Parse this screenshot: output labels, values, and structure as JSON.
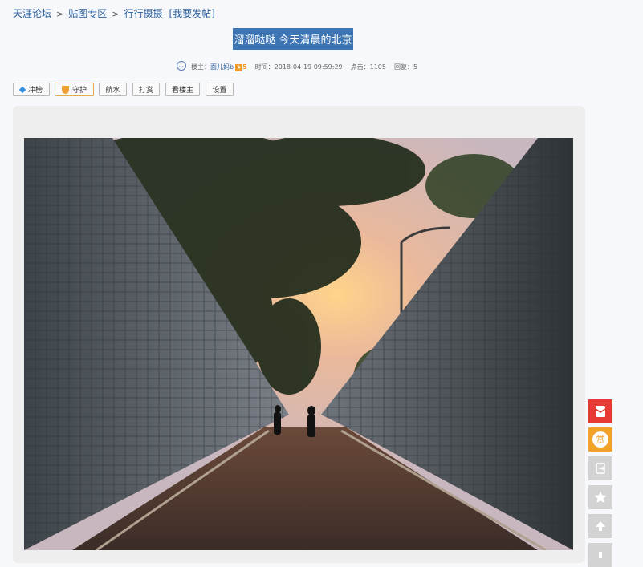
{
  "breadcrumb": {
    "items": [
      "天涯论坛",
      "贴图专区",
      "行行摄摄"
    ],
    "post_link": "[我要发帖]"
  },
  "post": {
    "title": "溜溜哒哒 今天清晨的北京",
    "meta": {
      "author_label": "楼主：",
      "author": "面儿妈b",
      "level": "5",
      "time_label": "时间：",
      "time": "2018-04-19 09:59:29",
      "clicks_label": "点击：",
      "clicks": "1105",
      "replies_label": "回复：",
      "replies": "5"
    }
  },
  "toolbar": {
    "buttons": [
      "冲榜",
      "守护",
      "航水",
      "打赏",
      "看楼主",
      "设置"
    ]
  },
  "sidebar": {
    "icons": [
      "red-envelope-icon",
      "reward-icon",
      "share-icon",
      "favorite-star-icon",
      "back-to-top-icon",
      "more-icon"
    ],
    "colors": {
      "red": "#e83a34",
      "orange": "#f2a12b",
      "gray": "#d3d3d3"
    },
    "reward_glyph": "赏"
  },
  "colors": {
    "link": "#2a5e9d",
    "title_bg": "#3d74b4",
    "page_bg": "#f6f8fb"
  }
}
